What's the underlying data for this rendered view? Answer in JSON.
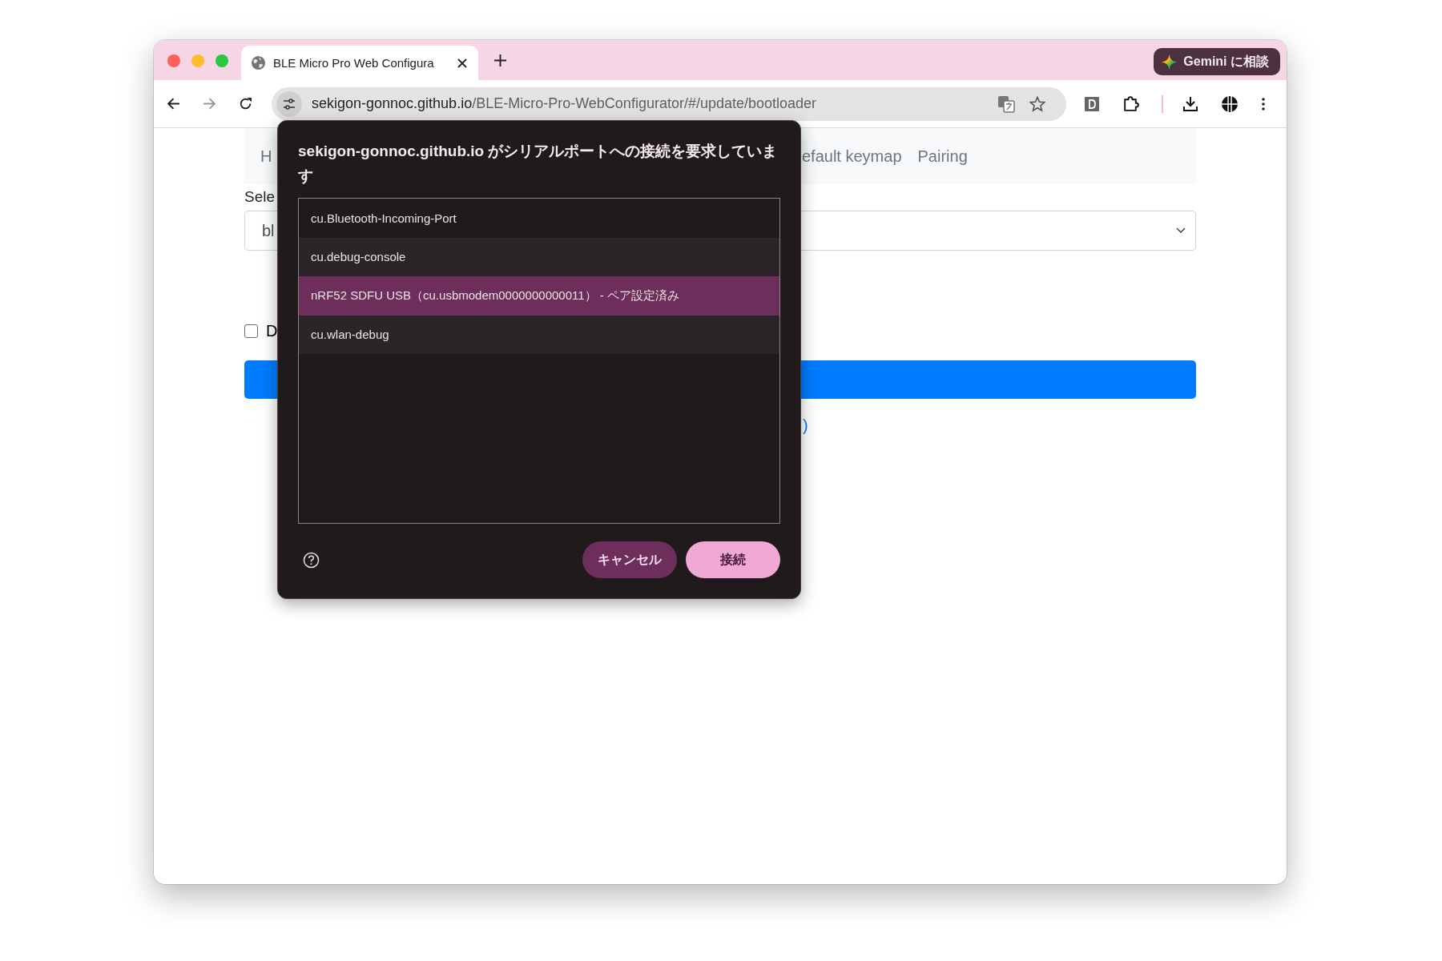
{
  "browser": {
    "tab": {
      "title": "BLE Micro Pro Web Configura",
      "selected": true
    },
    "gemini_button": "Gemini に相談",
    "address": {
      "host": "sekigon-gonnoc.github.io",
      "path": "/BLE-Micro-Pro-WebConfigurator/#/update/bootloader"
    }
  },
  "page": {
    "nav_items": [
      "H",
      "efault keymap",
      "Pairing"
    ],
    "select_label": "Sele",
    "select_value": "bl",
    "checkbox": {
      "label": "D",
      "checked": false
    },
    "link_fragment": ")"
  },
  "dialog": {
    "title": "sekigon-gonnoc.github.io がシリアルポートへの接続を要求しています",
    "ports": [
      {
        "label": "cu.Bluetooth-Incoming-Port",
        "selected": false
      },
      {
        "label": "cu.debug-console",
        "selected": false
      },
      {
        "label": "nRF52 SDFU USB（cu.usbmodem0000000000011） - ペア設定済み",
        "selected": true
      },
      {
        "label": "cu.wlan-debug",
        "selected": false
      }
    ],
    "buttons": [
      {
        "label": "キャンセル",
        "kind": "secondary"
      },
      {
        "label": "接続",
        "kind": "primary"
      }
    ]
  }
}
